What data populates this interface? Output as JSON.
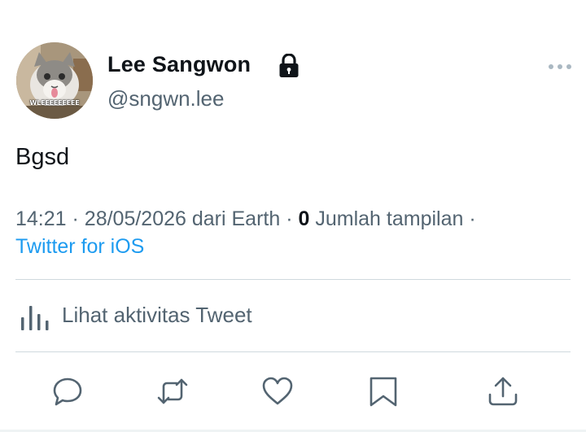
{
  "user": {
    "display_name": "Lee Sangwon",
    "handle": "@sngwn.lee",
    "avatar_caption": "WLEEEEEEEEE",
    "protected_icon": "lock-icon"
  },
  "tweet": {
    "text": "Bgsd"
  },
  "meta": {
    "time": "14:21",
    "date": "28/05/2026",
    "location": "dari Earth",
    "views_count": "0",
    "views_label": "Jumlah tampilan",
    "separator": "·",
    "source": "Twitter for iOS"
  },
  "activity": {
    "label": "Lihat aktivitas Tweet",
    "icon": "bar-chart-icon"
  },
  "actions": [
    {
      "name": "reply",
      "icon": "speech-bubble-icon"
    },
    {
      "name": "retweet",
      "icon": "retweet-icon"
    },
    {
      "name": "like",
      "icon": "heart-icon"
    },
    {
      "name": "bookmark",
      "icon": "bookmark-icon"
    },
    {
      "name": "share",
      "icon": "share-icon"
    }
  ],
  "colors": {
    "text_primary": "#0f1419",
    "text_secondary": "#536471",
    "link": "#1d9bf0",
    "divider": "#cfd9de"
  }
}
